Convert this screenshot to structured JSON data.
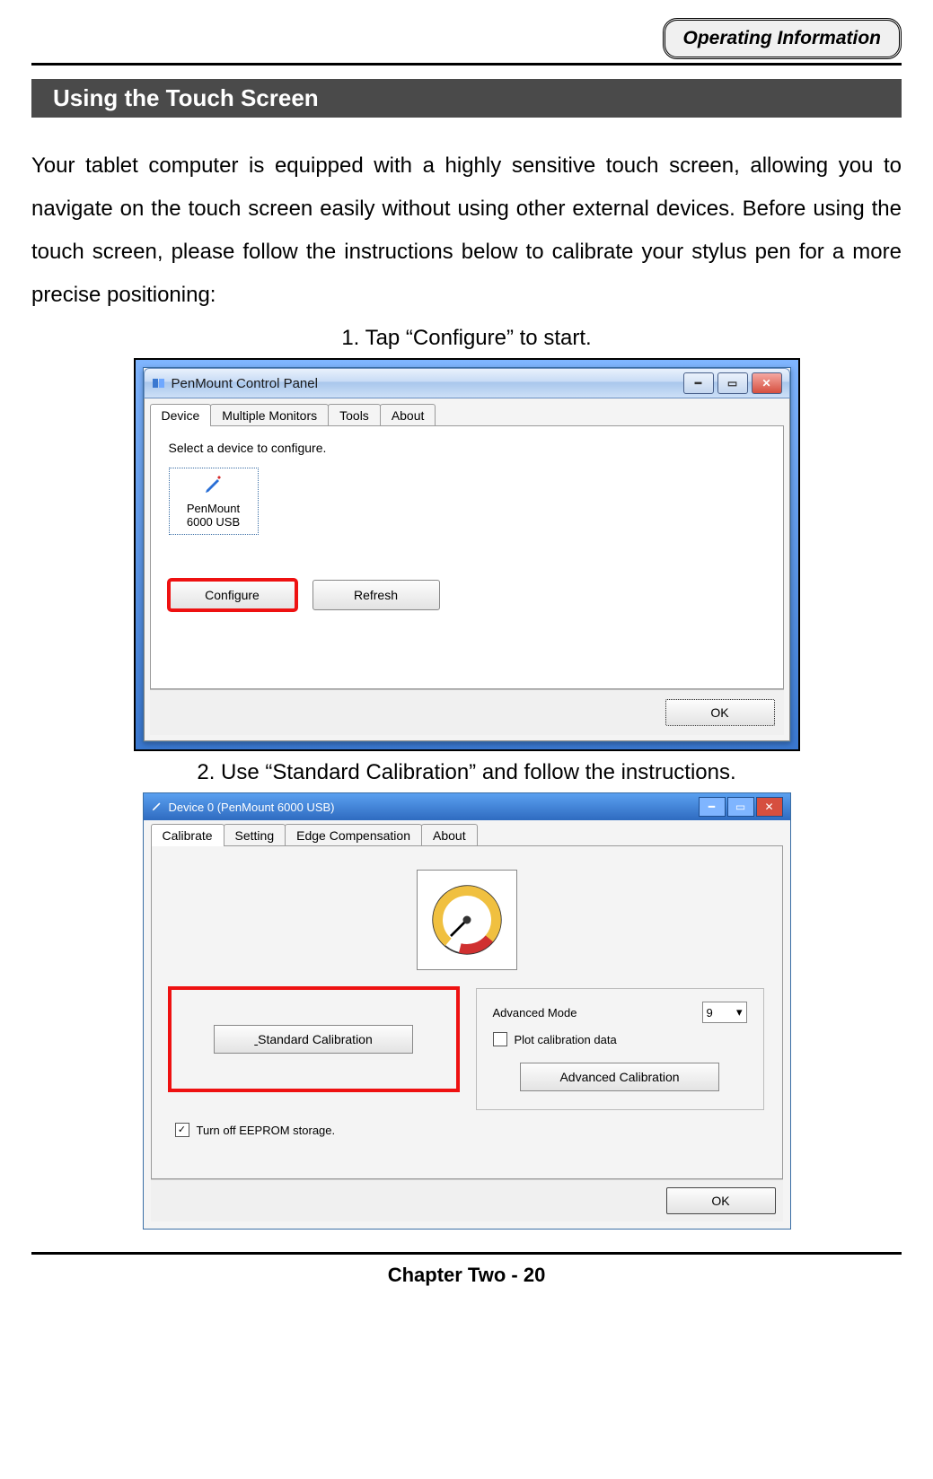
{
  "header": {
    "badge": "Operating Information"
  },
  "section_title": "Using the Touch Screen",
  "intro": "Your tablet computer is equipped with a highly sensitive touch screen, allowing you to navigate on the touch screen easily without using other external devices. Before using the touch screen, please follow the instructions below to calibrate your stylus pen for a more precise positioning:",
  "step1": {
    "caption": "1. Tap “Configure” to start.",
    "window_title": "PenMount Control Panel",
    "tabs": [
      "Device",
      "Multiple Monitors",
      "Tools",
      "About"
    ],
    "pane_label": "Select a device to configure.",
    "device_name_line1": "PenMount",
    "device_name_line2": "6000 USB",
    "btn_configure": "Configure",
    "btn_refresh": "Refresh",
    "btn_ok": "OK"
  },
  "step2": {
    "caption": "2. Use “Standard Calibration” and follow the instructions.",
    "window_title": "Device 0 (PenMount 6000 USB)",
    "tabs": [
      "Calibrate",
      "Setting",
      "Edge Compensation",
      "About"
    ],
    "advanced_mode_label": "Advanced Mode",
    "advanced_mode_value": "9",
    "plot_label": "Plot calibration data",
    "btn_standard": "Standard Calibration",
    "btn_advanced": "Advanced Calibration",
    "chk_eeprom": "Turn off EEPROM storage.",
    "btn_ok": "OK"
  },
  "footer": "Chapter Two - 20"
}
